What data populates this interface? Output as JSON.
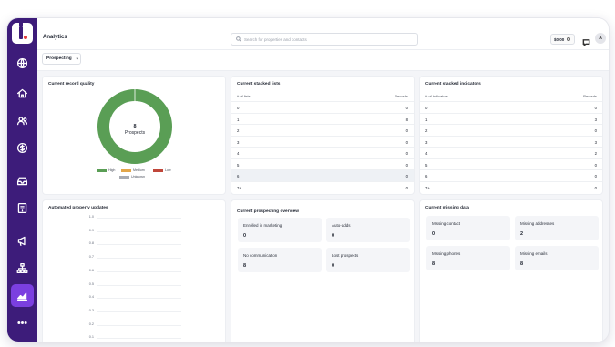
{
  "app": {
    "title": "Analytics"
  },
  "search": {
    "placeholder": "Search for properties and contacts"
  },
  "header": {
    "balance": "$0.00",
    "avatar_initial": "A"
  },
  "filter": {
    "selected": "Prospecting"
  },
  "sidebar": {
    "items": [
      {
        "name": "globe",
        "icon": "globe-icon",
        "active": false
      },
      {
        "name": "home",
        "icon": "home-icon",
        "active": false
      },
      {
        "name": "contacts",
        "icon": "users-icon",
        "active": false
      },
      {
        "name": "money",
        "icon": "dollar-icon",
        "active": false
      },
      {
        "name": "inbox",
        "icon": "inbox-icon",
        "active": false
      },
      {
        "name": "lists",
        "icon": "list-icon",
        "active": false
      },
      {
        "name": "marketing",
        "icon": "megaphone-icon",
        "active": false
      },
      {
        "name": "org",
        "icon": "sitemap-icon",
        "active": false
      },
      {
        "name": "analytics",
        "icon": "chart-icon",
        "active": true
      },
      {
        "name": "more",
        "icon": "more-icon",
        "active": false
      }
    ]
  },
  "record_quality": {
    "title": "Current record quality",
    "center_value": "8",
    "center_label": "Prospects",
    "legend": [
      {
        "label": "High",
        "color": "#5a9e55"
      },
      {
        "label": "Medium",
        "color": "#e2a64a"
      },
      {
        "label": "Low",
        "color": "#c0463a"
      },
      {
        "label": "Unknown",
        "color": "#a8abb2"
      }
    ]
  },
  "stacked_lists": {
    "title": "Current stacked lists",
    "col_left": "# of lists",
    "col_right": "Records",
    "rows": [
      {
        "k": "0",
        "v": "0"
      },
      {
        "k": "1",
        "v": "8"
      },
      {
        "k": "2",
        "v": "0"
      },
      {
        "k": "3",
        "v": "0"
      },
      {
        "k": "4",
        "v": "0"
      },
      {
        "k": "5",
        "v": "0"
      },
      {
        "k": "6",
        "v": "0"
      },
      {
        "k": "7+",
        "v": "0"
      }
    ]
  },
  "stacked_indicators": {
    "title": "Current stacked indicators",
    "col_left": "# of indicators",
    "col_right": "Records",
    "rows": [
      {
        "k": "0",
        "v": "0"
      },
      {
        "k": "1",
        "v": "3"
      },
      {
        "k": "2",
        "v": "0"
      },
      {
        "k": "3",
        "v": "3"
      },
      {
        "k": "4",
        "v": "2"
      },
      {
        "k": "5",
        "v": "0"
      },
      {
        "k": "6",
        "v": "0"
      },
      {
        "k": "7+",
        "v": "0"
      }
    ]
  },
  "property_updates": {
    "title": "Automated property updates",
    "yticks": [
      "1.0",
      "0.9",
      "0.8",
      "0.7",
      "0.6",
      "0.5",
      "0.4",
      "0.3",
      "0.2",
      "0.1"
    ]
  },
  "prospecting_overview": {
    "title": "Current prospecting overview",
    "tiles": [
      {
        "label": "Enrolled in marketing",
        "value": "0"
      },
      {
        "label": "Auto-adds",
        "value": "0"
      },
      {
        "label": "No communication",
        "value": "8"
      },
      {
        "label": "Lost prospects",
        "value": "0"
      }
    ]
  },
  "missing_data": {
    "title": "Current missing data",
    "tiles": [
      {
        "label": "Missing contact",
        "value": "0"
      },
      {
        "label": "Missing addresses",
        "value": "2"
      },
      {
        "label": "Missing phones",
        "value": "8"
      },
      {
        "label": "Missing emails",
        "value": "8"
      }
    ]
  },
  "chart_data": {
    "type": "pie",
    "categories": [
      "High",
      "Medium",
      "Low",
      "Unknown"
    ],
    "values": [
      8,
      0,
      0,
      0
    ],
    "colors": [
      "#5a9e55",
      "#e2a64a",
      "#c0463a",
      "#a8abb2"
    ],
    "title": "Current record quality"
  }
}
